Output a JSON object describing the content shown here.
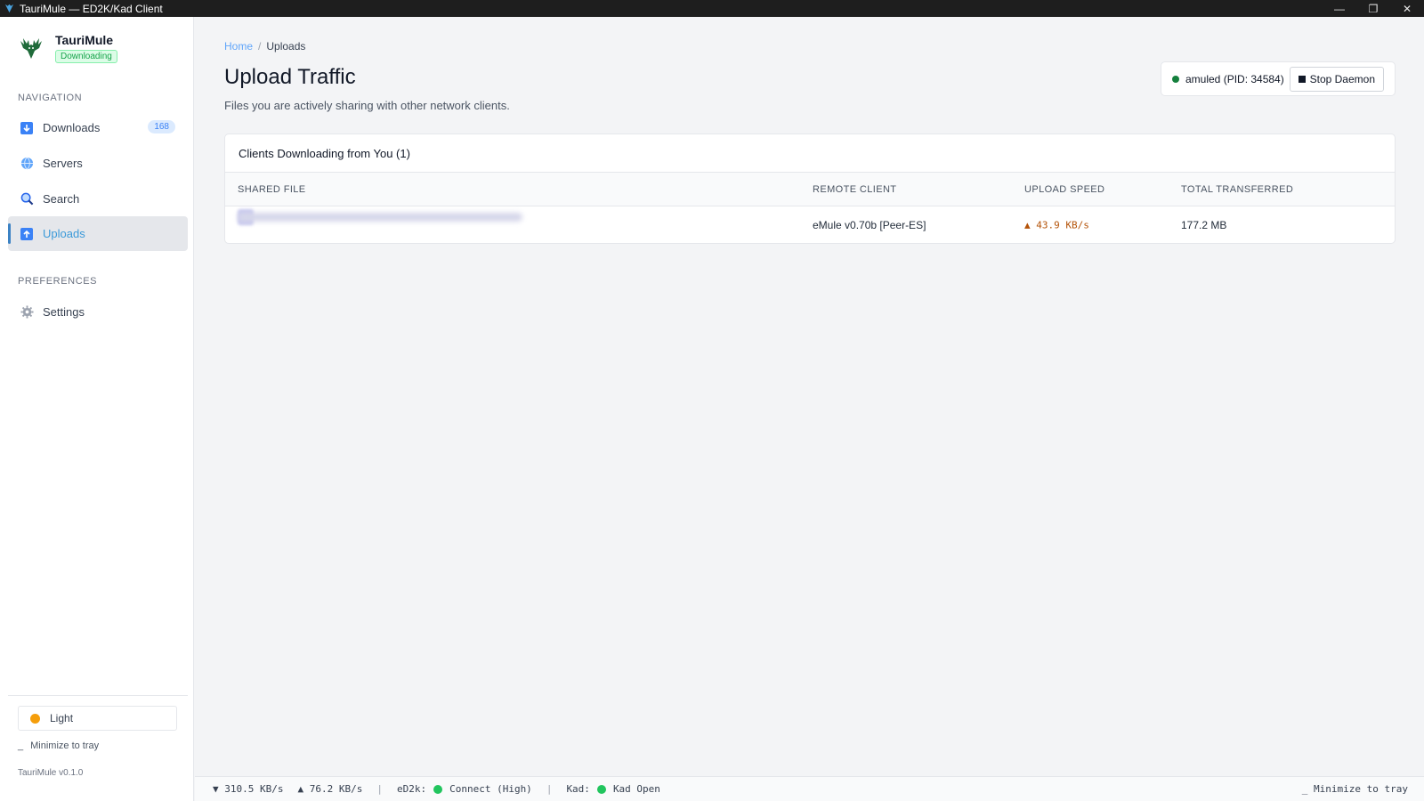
{
  "window": {
    "title": "TauriMule — ED2K/Kad Client",
    "minimize_glyph": "—",
    "restore_glyph": "❐",
    "close_glyph": "✕"
  },
  "brand": {
    "name": "TauriMule",
    "status_badge": "Downloading",
    "logo_icon": "stag-logo-icon"
  },
  "sidebar": {
    "navigation_label": "NAVIGATION",
    "items": [
      {
        "label": "Downloads",
        "icon": "download-icon",
        "count": "168",
        "active": false
      },
      {
        "label": "Servers",
        "icon": "globe-icon",
        "count": "",
        "active": false
      },
      {
        "label": "Search",
        "icon": "search-icon",
        "count": "",
        "active": false
      },
      {
        "label": "Uploads",
        "icon": "upload-icon",
        "count": "",
        "active": true
      }
    ],
    "preferences_label": "PREFERENCES",
    "settings_label": "Settings",
    "theme_label": "Light",
    "minimize_label": "Minimize to tray",
    "version": "TauriMule v0.1.0"
  },
  "main": {
    "breadcrumb": {
      "home": "Home",
      "current": "Uploads"
    },
    "title": "Upload Traffic",
    "subtitle": "Files you are actively sharing with other network clients.",
    "daemon": {
      "status": "amuled (PID: 34584)",
      "stop_label": "Stop Daemon"
    },
    "card": {
      "title": "Clients Downloading from You (1)",
      "columns": [
        "SHARED FILE",
        "REMOTE CLIENT",
        "UPLOAD SPEED",
        "TOTAL TRANSFERRED"
      ],
      "rows": [
        {
          "file": "",
          "client": "eMule v0.70b [Peer-ES]",
          "speed": "▲ 43.9 KB/s",
          "total": "177.2 MB"
        }
      ]
    }
  },
  "statusbar": {
    "down": "▼ 310.5 KB/s",
    "up": "▲ 76.2 KB/s",
    "ed2k_label": "eD2k:",
    "ed2k_status": "Connect (High)",
    "kad_label": "Kad:",
    "kad_status": "Kad Open",
    "minimize": "_ Minimize to tray"
  },
  "colors": {
    "accent": "#3b9ad9",
    "success": "#22c55e",
    "upload_speed": "#b45309"
  }
}
